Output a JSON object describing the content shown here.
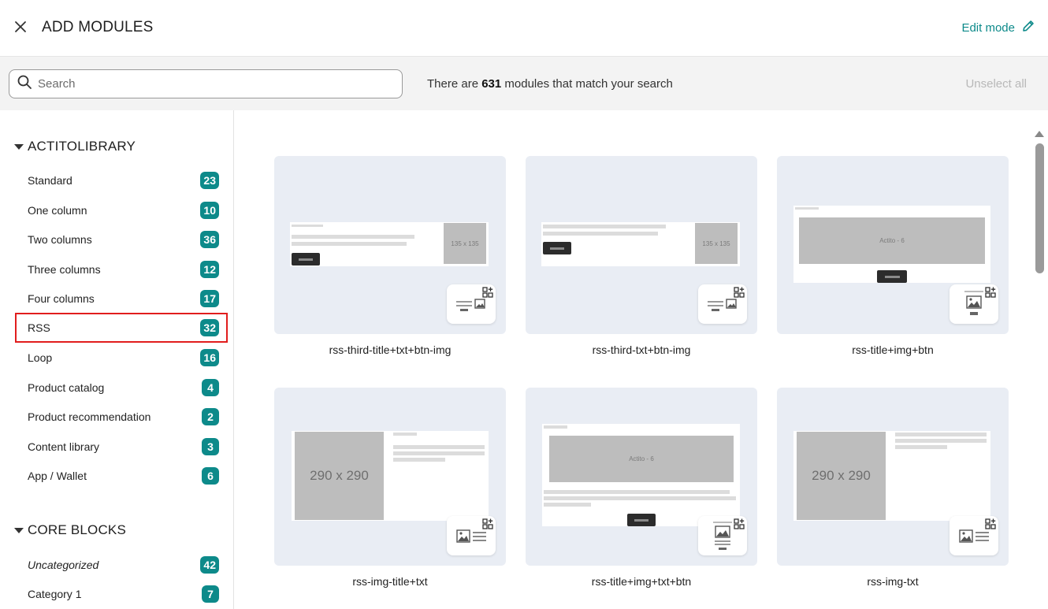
{
  "header": {
    "title": "ADD MODULES",
    "edit_mode_label": "Edit mode"
  },
  "search": {
    "placeholder": "Search",
    "value": "",
    "match_prefix": "There are ",
    "match_count": "631",
    "match_suffix": " modules that match your search",
    "unselect_all_label": "Unselect all"
  },
  "sidebar": {
    "groups": [
      {
        "title": "ACTITOLIBRARY",
        "items": [
          {
            "label": "Standard",
            "count": "23"
          },
          {
            "label": "One column",
            "count": "10"
          },
          {
            "label": "Two columns",
            "count": "36"
          },
          {
            "label": "Three columns",
            "count": "12"
          },
          {
            "label": "Four columns",
            "count": "17"
          },
          {
            "label": "RSS",
            "count": "32",
            "selected": true
          },
          {
            "label": "Loop",
            "count": "16"
          },
          {
            "label": "Product catalog",
            "count": "4"
          },
          {
            "label": "Product recommendation",
            "count": "2"
          },
          {
            "label": "Content library",
            "count": "3"
          },
          {
            "label": "App / Wallet",
            "count": "6"
          }
        ]
      },
      {
        "title": "CORE BLOCKS",
        "items": [
          {
            "label": "Uncategorized",
            "count": "42",
            "italic": true
          },
          {
            "label": "Category 1",
            "count": "7"
          }
        ]
      }
    ]
  },
  "modules": [
    {
      "name": "rss-third-title+txt+btn-img",
      "thumb_text": "135 x 135",
      "icon": "text-image-icon"
    },
    {
      "name": "rss-third-txt+btn-img",
      "thumb_text": "135 x 135",
      "icon": "text-image-icon"
    },
    {
      "name": "rss-title+img+btn",
      "thumb_text": "Actito - 6",
      "icon": "title-image-button-icon"
    },
    {
      "name": "rss-img-title+txt",
      "thumb_text": "290 x 290",
      "icon": "image-text-icon"
    },
    {
      "name": "rss-title+img+txt+btn",
      "thumb_text": "Actito - 6",
      "icon": "title-image-text-button-icon"
    },
    {
      "name": "rss-img-txt",
      "thumb_text": "290 x 290",
      "icon": "image-text-icon"
    }
  ],
  "colors": {
    "accent": "#0d8a8a",
    "selected_outline": "#e11d1d",
    "thumb_bg": "#e9edf4"
  }
}
